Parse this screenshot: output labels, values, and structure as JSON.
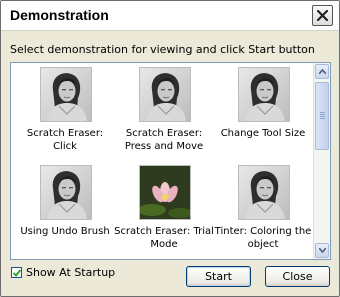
{
  "window": {
    "title": "Demonstration"
  },
  "instruction": "Select demonstration for viewing and click Start button",
  "demos": [
    {
      "label": "Scratch Eraser: Click",
      "image": "portrait-photo"
    },
    {
      "label": "Scratch Eraser: Press and Move",
      "image": "portrait-photo"
    },
    {
      "label": "Change Tool Size",
      "image": "portrait-photo"
    },
    {
      "label": "Using Undo Brush",
      "image": "portrait-photo"
    },
    {
      "label": "Scratch Eraser: Trial Mode",
      "image": "lotus-flower-photo"
    },
    {
      "label": "Tinter: Coloring the object",
      "image": "portrait-photo"
    }
  ],
  "show_at_startup": {
    "label": "Show At Startup",
    "checked": true
  },
  "buttons": {
    "start": "Start",
    "close": "Close"
  }
}
